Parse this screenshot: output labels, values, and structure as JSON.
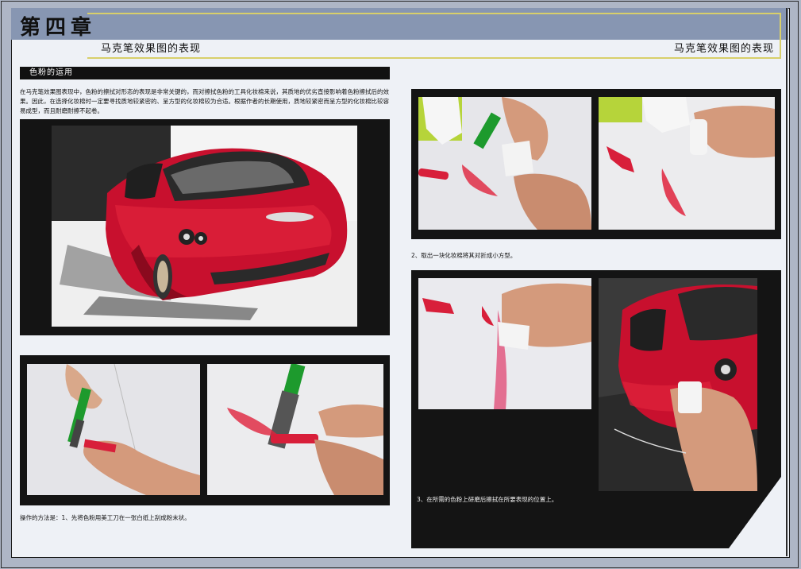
{
  "header": {
    "chapter": "第四章",
    "subtitle_left": "马克笔效果图的表现",
    "subtitle_right": "马克笔效果图的表现"
  },
  "section": {
    "title": "色粉的运用",
    "intro": "在马克笔效果图表现中，色粉的擦拭对形态的表现是非常关键的，而对擦拭色粉的工具化妆棉来说，其质地的优劣直接影响着色粉擦拭后的效果。因此，在选择化妆棉时一定要寻找质地较紧密的、呈方型的化妆棉较为合适。根据作者的长期使用，质地较紧密而呈方型的化妆棉比较容易成型，而且耐磨耐擦不起卷。"
  },
  "captions": {
    "step1": "操作的方法是：1、先将色粉用美工刀在一张白纸上刮成粉末状。",
    "step2": "2、取出一块化妆棉将其对折成小方型。",
    "step3": "3、在所需的色粉上研磨后擦拭在所要表现的位置上。"
  },
  "colors": {
    "header_band": "#8796b2",
    "accent_yellow": "#d8cf6a",
    "car_red": "#c8102e",
    "panel_black": "#141414"
  }
}
